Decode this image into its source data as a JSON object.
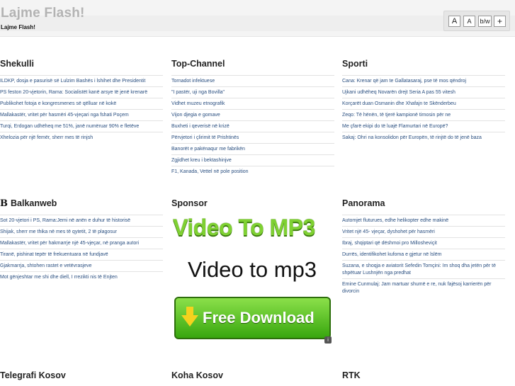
{
  "header": {
    "site_title": "Lajme Flash!",
    "site_subtitle": "Lajme Flash!",
    "toolbar": {
      "font_large": "A",
      "font_small": "A",
      "contrast": "b/w",
      "add": "+"
    }
  },
  "sections": [
    {
      "title": "Shekulli",
      "items": [
        "ILDKP, dosja e pasurisë së Lulzim Bashës i lshihet dhe Presidentit",
        "PS feston 20-vjetorin, Rama: Socialistët kanë arsye të jenë krenarë",
        "Publikohet fotoja e kongresmenes së qëlluar në kokë",
        "Mallakastër, vritet për hasmëri 45-vjeçari nga fshati Poçem",
        "Turqi, Erdogan udhëheq me 51%, janë numëruar 90% e fletëve",
        "Xhelozia për një femër, sherr mes të rinjsh"
      ]
    },
    {
      "title": "Top-Channel",
      "items": [
        "Tornadot infektuese",
        "\"I pastër, uji nga Bovilla\"",
        "Vidhet muzeu etnografik",
        "Vijon djegia e gomave",
        "Buxheti i qeverisë në krizë",
        "Përvjetori i çlirimit të Prishtinës",
        "Banorët e pakënaqur me fabrikën",
        "Zgjidhet kreu i bektashinjve",
        "F1, Kanada, Vettel në pole position"
      ]
    },
    {
      "title": "Sporti",
      "items": [
        "Cana: Krenar që jam te Gallatasaraj, pse të mos qëndroj",
        "Ujkani udhëheq Novarën drejt Seria A pas 55 vitesh",
        "Korçarët duan Osmanin dhe Xhafajn te Skënderbeu",
        "Zeqo: Të hënën, të tjerë kampionë tirnosin për ne",
        "Me çfarë ekipi do të luajë Flamurtari në Europë?",
        "Sakaj: Ohri na konsolidon për Europën, të rinjtë do të jenë baza"
      ]
    },
    {
      "title": "Balkanweb",
      "icon": "B",
      "items": [
        "Sot 20-vjetori i PS, Rama:Jemi në anën e duhur të historisë",
        "Shijak, sherr me thika në mes të qytetit, 2 të plagosur",
        "Mallakastër, vritet për hakmarrje një 45-vjeçar, në pranga autori",
        "Tiranë, pishinat tepër të frekuentuara në fundjavë",
        "Gjakmarrja, shtohen rastet e vetëvrasjeve",
        "Mot gënjeshtar me shi dhe diell, I rrezikti nis të Enjten"
      ]
    },
    {
      "title": "Sponsor",
      "banner": {
        "headline": "Video To MP3",
        "tagline": "Video to mp3",
        "button": "Free Download"
      }
    },
    {
      "title": "Panorama",
      "items": [
        "Automjet fluturues, edhe helikopter edhe makinë",
        "Vritet një 45- vjeçar, dyshohet për hasmëri",
        "Ibraj, shqiptari që dëshmoi pro Millosheviçit",
        "Durrës, identifikohet kufoma e gjetur në lslëm",
        "Suzana, e shoqja e aviatorit Sefedin Tomçini: Im shoq dha jetën për të shpëtuar Lushnjën nga predhat",
        "Emine Cunmulaj: Jam martuar shumë e re, nuk fajësoj karrierën për divorcin"
      ]
    },
    {
      "title": "Telegrafi Kosov",
      "items": []
    },
    {
      "title": "Koha Kosov",
      "items": []
    },
    {
      "title": "RTK",
      "items": []
    }
  ]
}
